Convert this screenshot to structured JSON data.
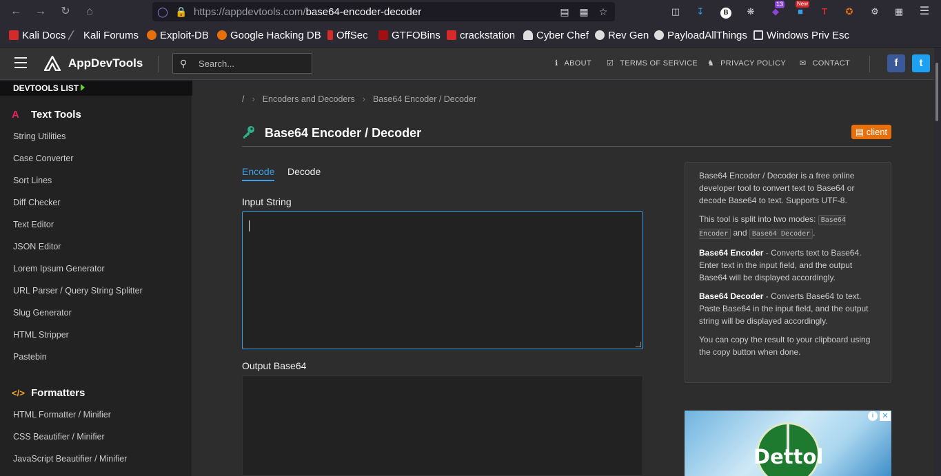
{
  "browser": {
    "url_host": "https://appdevtools.com/",
    "url_path": "base64-encoder-decoder",
    "extension_badge_count": "13",
    "extension_new_badge": "New"
  },
  "bookmarks": [
    {
      "label": "Kali Docs",
      "color": "#d52a2a"
    },
    {
      "label": "Kali Forums",
      "color": "#888888"
    },
    {
      "label": "Exploit-DB",
      "color": "#e8700c"
    },
    {
      "label": "Google Hacking DB",
      "color": "#e8700c"
    },
    {
      "label": "OffSec",
      "color": "#d52a2a"
    },
    {
      "label": "GTFOBins",
      "color": "#a01010"
    },
    {
      "label": "crackstation",
      "color": "#d52a2a"
    },
    {
      "label": "Cyber Chef",
      "color": "#dddddd"
    },
    {
      "label": "Rev Gen",
      "color": "#dddddd"
    },
    {
      "label": "PayloadAllThings",
      "color": "#dddddd"
    },
    {
      "label": "Windows Priv Esc",
      "color": "#dddddd"
    }
  ],
  "header": {
    "brand": "AppDevTools",
    "search_placeholder": "Search...",
    "links": [
      "ABOUT",
      "TERMS OF SERVICE",
      "PRIVACY POLICY",
      "CONTACT"
    ],
    "facebook_glyph": "f",
    "twitter_glyph": "t"
  },
  "sidebar": {
    "devtools_label": "DEVTOOLS LIST",
    "categories": [
      {
        "title": "Text Tools",
        "icon_glyph": "A",
        "icon_color": "#e8245f",
        "items": [
          "String Utilities",
          "Case Converter",
          "Sort Lines",
          "Diff Checker",
          "Text Editor",
          "JSON Editor",
          "Lorem Ipsum Generator",
          "URL Parser / Query String Splitter",
          "Slug Generator",
          "HTML Stripper",
          "Pastebin"
        ]
      },
      {
        "title": "Formatters",
        "icon_glyph": "</>",
        "icon_color": "#f0a020",
        "items": [
          "HTML Formatter / Minifier",
          "CSS Beautifier / Minifier",
          "JavaScript Beautifier / Minifier"
        ]
      }
    ]
  },
  "main": {
    "breadcrumb": [
      "/",
      "Encoders and Decoders",
      "Base64 Encoder / Decoder"
    ],
    "title": "Base64 Encoder / Decoder",
    "badge": "client",
    "tabs": [
      "Encode",
      "Decode"
    ],
    "input_label": "Input String",
    "input_value": "",
    "output_label": "Output Base64",
    "output_value": ""
  },
  "info": {
    "intro": "Base64 Encoder / Decoder is a free online developer tool to convert text to Base64 or decode Base64 to text. Supports UTF-8.",
    "modes_prefix": "This tool is split into two modes:",
    "mode1": "Base64 Encoder",
    "and_word": "and",
    "mode2": "Base64 Decoder",
    "period": ".",
    "encoder_title": "Base64 Encoder",
    "encoder_desc": "- Converts text to Base64. Enter text in the input field, and the output Base64 will be displayed accordingly.",
    "decoder_title": "Base64 Decoder",
    "decoder_desc": "- Converts Base64 to text. Paste Base64 in the input field, and the output string will be displayed accordingly.",
    "copy_note": "You can copy the result to your clipboard using the copy button when done."
  },
  "ad": {
    "brand": "Dettol"
  }
}
